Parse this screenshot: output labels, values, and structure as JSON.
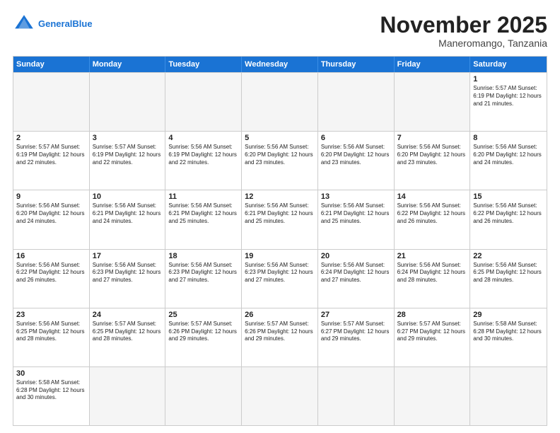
{
  "logo": {
    "general": "General",
    "blue": "Blue"
  },
  "title": "November 2025",
  "subtitle": "Maneromango, Tanzania",
  "days": [
    "Sunday",
    "Monday",
    "Tuesday",
    "Wednesday",
    "Thursday",
    "Friday",
    "Saturday"
  ],
  "weeks": [
    [
      {
        "day": "",
        "empty": true,
        "text": ""
      },
      {
        "day": "",
        "empty": true,
        "text": ""
      },
      {
        "day": "",
        "empty": true,
        "text": ""
      },
      {
        "day": "",
        "empty": true,
        "text": ""
      },
      {
        "day": "",
        "empty": true,
        "text": ""
      },
      {
        "day": "",
        "empty": true,
        "text": ""
      },
      {
        "day": "1",
        "empty": false,
        "text": "Sunrise: 5:57 AM\nSunset: 6:19 PM\nDaylight: 12 hours and 21 minutes."
      }
    ],
    [
      {
        "day": "2",
        "empty": false,
        "text": "Sunrise: 5:57 AM\nSunset: 6:19 PM\nDaylight: 12 hours and 22 minutes."
      },
      {
        "day": "3",
        "empty": false,
        "text": "Sunrise: 5:57 AM\nSunset: 6:19 PM\nDaylight: 12 hours and 22 minutes."
      },
      {
        "day": "4",
        "empty": false,
        "text": "Sunrise: 5:56 AM\nSunset: 6:19 PM\nDaylight: 12 hours and 22 minutes."
      },
      {
        "day": "5",
        "empty": false,
        "text": "Sunrise: 5:56 AM\nSunset: 6:20 PM\nDaylight: 12 hours and 23 minutes."
      },
      {
        "day": "6",
        "empty": false,
        "text": "Sunrise: 5:56 AM\nSunset: 6:20 PM\nDaylight: 12 hours and 23 minutes."
      },
      {
        "day": "7",
        "empty": false,
        "text": "Sunrise: 5:56 AM\nSunset: 6:20 PM\nDaylight: 12 hours and 23 minutes."
      },
      {
        "day": "8",
        "empty": false,
        "text": "Sunrise: 5:56 AM\nSunset: 6:20 PM\nDaylight: 12 hours and 24 minutes."
      }
    ],
    [
      {
        "day": "9",
        "empty": false,
        "text": "Sunrise: 5:56 AM\nSunset: 6:20 PM\nDaylight: 12 hours and 24 minutes."
      },
      {
        "day": "10",
        "empty": false,
        "text": "Sunrise: 5:56 AM\nSunset: 6:21 PM\nDaylight: 12 hours and 24 minutes."
      },
      {
        "day": "11",
        "empty": false,
        "text": "Sunrise: 5:56 AM\nSunset: 6:21 PM\nDaylight: 12 hours and 25 minutes."
      },
      {
        "day": "12",
        "empty": false,
        "text": "Sunrise: 5:56 AM\nSunset: 6:21 PM\nDaylight: 12 hours and 25 minutes."
      },
      {
        "day": "13",
        "empty": false,
        "text": "Sunrise: 5:56 AM\nSunset: 6:21 PM\nDaylight: 12 hours and 25 minutes."
      },
      {
        "day": "14",
        "empty": false,
        "text": "Sunrise: 5:56 AM\nSunset: 6:22 PM\nDaylight: 12 hours and 26 minutes."
      },
      {
        "day": "15",
        "empty": false,
        "text": "Sunrise: 5:56 AM\nSunset: 6:22 PM\nDaylight: 12 hours and 26 minutes."
      }
    ],
    [
      {
        "day": "16",
        "empty": false,
        "text": "Sunrise: 5:56 AM\nSunset: 6:22 PM\nDaylight: 12 hours and 26 minutes."
      },
      {
        "day": "17",
        "empty": false,
        "text": "Sunrise: 5:56 AM\nSunset: 6:23 PM\nDaylight: 12 hours and 27 minutes."
      },
      {
        "day": "18",
        "empty": false,
        "text": "Sunrise: 5:56 AM\nSunset: 6:23 PM\nDaylight: 12 hours and 27 minutes."
      },
      {
        "day": "19",
        "empty": false,
        "text": "Sunrise: 5:56 AM\nSunset: 6:23 PM\nDaylight: 12 hours and 27 minutes."
      },
      {
        "day": "20",
        "empty": false,
        "text": "Sunrise: 5:56 AM\nSunset: 6:24 PM\nDaylight: 12 hours and 27 minutes."
      },
      {
        "day": "21",
        "empty": false,
        "text": "Sunrise: 5:56 AM\nSunset: 6:24 PM\nDaylight: 12 hours and 28 minutes."
      },
      {
        "day": "22",
        "empty": false,
        "text": "Sunrise: 5:56 AM\nSunset: 6:25 PM\nDaylight: 12 hours and 28 minutes."
      }
    ],
    [
      {
        "day": "23",
        "empty": false,
        "text": "Sunrise: 5:56 AM\nSunset: 6:25 PM\nDaylight: 12 hours and 28 minutes."
      },
      {
        "day": "24",
        "empty": false,
        "text": "Sunrise: 5:57 AM\nSunset: 6:25 PM\nDaylight: 12 hours and 28 minutes."
      },
      {
        "day": "25",
        "empty": false,
        "text": "Sunrise: 5:57 AM\nSunset: 6:26 PM\nDaylight: 12 hours and 29 minutes."
      },
      {
        "day": "26",
        "empty": false,
        "text": "Sunrise: 5:57 AM\nSunset: 6:26 PM\nDaylight: 12 hours and 29 minutes."
      },
      {
        "day": "27",
        "empty": false,
        "text": "Sunrise: 5:57 AM\nSunset: 6:27 PM\nDaylight: 12 hours and 29 minutes."
      },
      {
        "day": "28",
        "empty": false,
        "text": "Sunrise: 5:57 AM\nSunset: 6:27 PM\nDaylight: 12 hours and 29 minutes."
      },
      {
        "day": "29",
        "empty": false,
        "text": "Sunrise: 5:58 AM\nSunset: 6:28 PM\nDaylight: 12 hours and 30 minutes."
      }
    ],
    [
      {
        "day": "30",
        "empty": false,
        "text": "Sunrise: 5:58 AM\nSunset: 6:28 PM\nDaylight: 12 hours and 30 minutes."
      },
      {
        "day": "",
        "empty": true,
        "text": ""
      },
      {
        "day": "",
        "empty": true,
        "text": ""
      },
      {
        "day": "",
        "empty": true,
        "text": ""
      },
      {
        "day": "",
        "empty": true,
        "text": ""
      },
      {
        "day": "",
        "empty": true,
        "text": ""
      },
      {
        "day": "",
        "empty": true,
        "text": ""
      }
    ]
  ]
}
